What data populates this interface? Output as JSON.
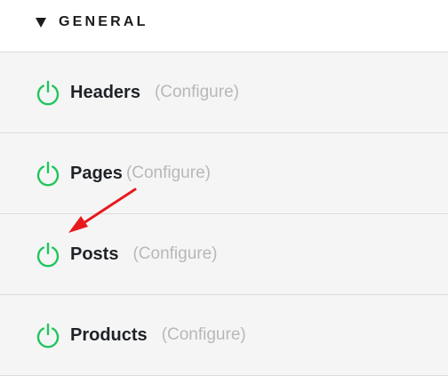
{
  "section": {
    "title": "GENERAL",
    "collapse_icon": "triangle-down-icon"
  },
  "modules": [
    {
      "name": "Headers",
      "configure_label": "(Configure)",
      "status_icon": "power-icon",
      "status_color": "#22c55e"
    },
    {
      "name": "Pages",
      "configure_label": "(Configure)",
      "status_icon": "power-icon",
      "status_color": "#22c55e"
    },
    {
      "name": "Posts",
      "configure_label": "(Configure)",
      "status_icon": "power-icon",
      "status_color": "#22c55e"
    },
    {
      "name": "Products",
      "configure_label": "(Configure)",
      "status_icon": "power-icon",
      "status_color": "#22c55e"
    }
  ],
  "annotation": {
    "icon": "red-arrow-icon",
    "color": "#e8191c"
  },
  "colors": {
    "power_on": "#22c55e",
    "row_background": "#f5f5f5",
    "configure_text": "#b8b8b8"
  }
}
